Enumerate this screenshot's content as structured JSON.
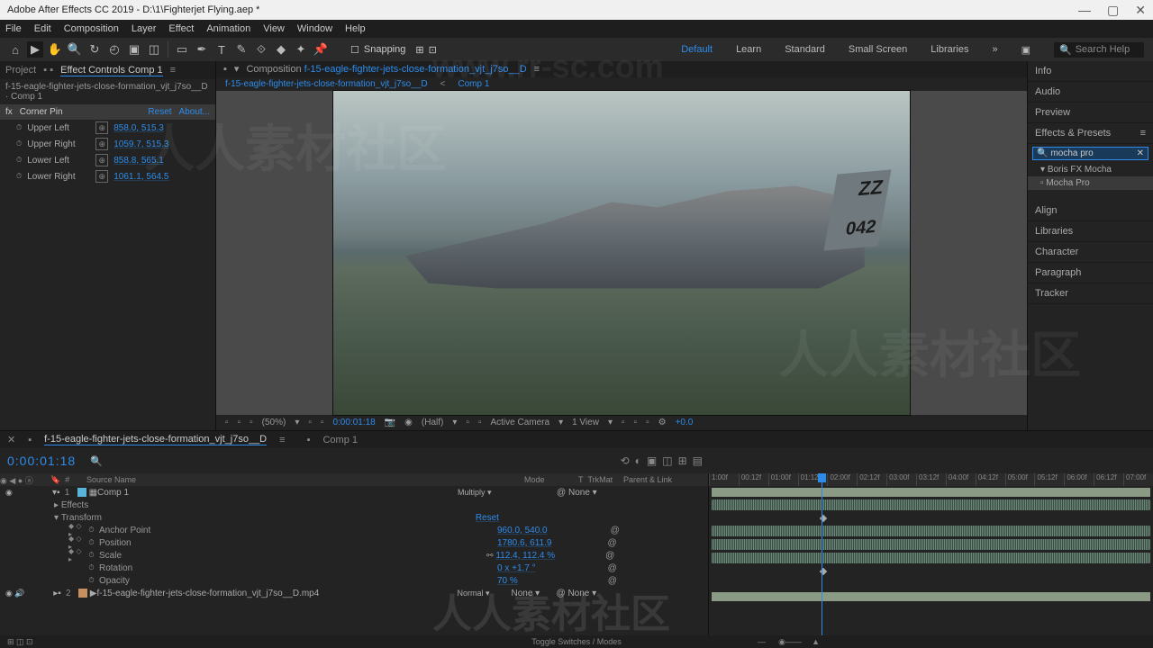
{
  "titlebar": {
    "app": "Adobe After Effects CC 2019 - D:\\1\\Fighterjet Flying.aep *"
  },
  "menu": [
    "File",
    "Edit",
    "Composition",
    "Layer",
    "Effect",
    "Animation",
    "View",
    "Window",
    "Help"
  ],
  "toolbar": {
    "snapping": "Snapping"
  },
  "workspaces": {
    "default": "Default",
    "learn": "Learn",
    "standard": "Standard",
    "small": "Small Screen",
    "libraries": "Libraries",
    "search": "Search Help"
  },
  "left": {
    "project": "Project",
    "ec": "Effect Controls Comp 1",
    "path": "f-15-eagle-fighter-jets-close-formation_vjt_j7so__D · Comp 1",
    "fxname": "Corner Pin",
    "reset": "Reset",
    "about": "About...",
    "rows": [
      {
        "label": "Upper Left",
        "val": "858.0, 515.3"
      },
      {
        "label": "Upper Right",
        "val": "1059.7, 515.3"
      },
      {
        "label": "Lower Left",
        "val": "858.8, 565.1"
      },
      {
        "label": "Lower Right",
        "val": "1061.1, 564.5"
      }
    ]
  },
  "viewer": {
    "comp_prefix": "Composition",
    "comp_name": "f-15-eagle-fighter-jets-close-formation_vjt_j7so__D",
    "bc1": "f-15-eagle-fighter-jets-close-formation_vjt_j7so__D",
    "bc2": "Comp 1",
    "jet_tail_top": "ZZ",
    "jet_tail_num": "042",
    "zoom": "(50%)",
    "tc": "0:00:01:18",
    "res": "(Half)",
    "cam": "Active Camera",
    "view": "1 View",
    "exp": "+0.0"
  },
  "right": {
    "info": "Info",
    "audio": "Audio",
    "preview": "Preview",
    "ep": "Effects & Presets",
    "search": "mocha pro",
    "grp": "Boris FX Mocha",
    "item": "Mocha Pro",
    "align": "Align",
    "libs": "Libraries",
    "char": "Character",
    "para": "Paragraph",
    "track": "Tracker"
  },
  "comptabs": {
    "a": "f-15-eagle-fighter-jets-close-formation_vjt_j7so__D",
    "b": "Comp 1"
  },
  "timeline": {
    "tc": "0:00:01:18",
    "cols": {
      "src": "Source Name",
      "mode": "Mode",
      "t": "T",
      "trk": "TrkMat",
      "par": "Parent & Link"
    },
    "ruler": [
      "1:00f",
      "00:12f",
      "01:00f",
      "01:12f",
      "02:00f",
      "02:12f",
      "03:00f",
      "03:12f",
      "04:00f",
      "04:12f",
      "05:00f",
      "05:12f",
      "06:00f",
      "06:12f",
      "07:00f"
    ],
    "layer1": {
      "num": "1",
      "name": "Comp 1",
      "mode": "Multiply",
      "par": "None"
    },
    "effects": "Effects",
    "transform": "Transform",
    "transform_reset": "Reset",
    "props": [
      {
        "name": "Anchor Point",
        "val": "960.0, 540.0"
      },
      {
        "name": "Position",
        "val": "1780.6, 611.9"
      },
      {
        "name": "Scale",
        "val": "112.4, 112.4 %"
      },
      {
        "name": "Rotation",
        "val": "0 x +1.7 °"
      },
      {
        "name": "Opacity",
        "val": "70 %"
      }
    ],
    "layer2": {
      "num": "2",
      "name": "f-15-eagle-fighter-jets-close-formation_vjt_j7so__D.mp4",
      "mode": "Normal",
      "trk": "None",
      "par": "None"
    },
    "foot": "Toggle Switches / Modes"
  },
  "watermark": {
    "url": "www.rr-sc.com",
    "cn": "人人素材社区"
  }
}
